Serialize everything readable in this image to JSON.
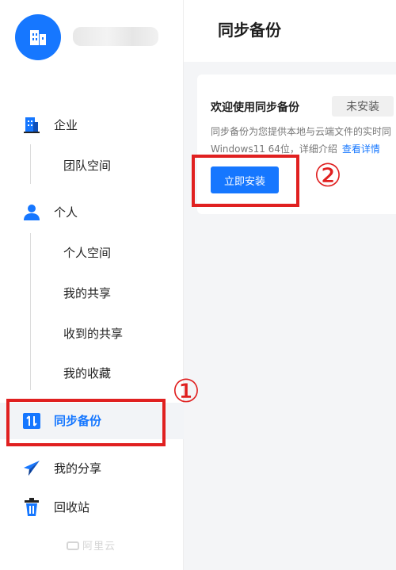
{
  "header": {
    "title": "同步备份"
  },
  "sidebar": {
    "items": [
      {
        "label": "企业",
        "icon": "building-icon"
      },
      {
        "label": "团队空间"
      },
      {
        "label": "个人",
        "icon": "person-icon"
      },
      {
        "label": "个人空间"
      },
      {
        "label": "我的共享"
      },
      {
        "label": "收到的共享"
      },
      {
        "label": "我的收藏"
      },
      {
        "label": "同步备份",
        "icon": "sync-backup-icon",
        "active": true
      },
      {
        "label": "我的分享",
        "icon": "paper-plane-icon"
      },
      {
        "label": "回收站",
        "icon": "trash-icon"
      }
    ],
    "footer_brand": "阿里云"
  },
  "card": {
    "welcome": "欢迎使用同步备份",
    "status": "未安装",
    "desc_line1": "同步备份为您提供本地与云端文件的实时同",
    "desc_line2": "Windows11 64位，详细介绍",
    "detail_link": "查看详情",
    "install_button": "立即安装"
  },
  "annotations": {
    "marker_1": "①",
    "marker_2": "②"
  },
  "colors": {
    "accent": "#1677ff",
    "annotation_red": "#e02020"
  }
}
